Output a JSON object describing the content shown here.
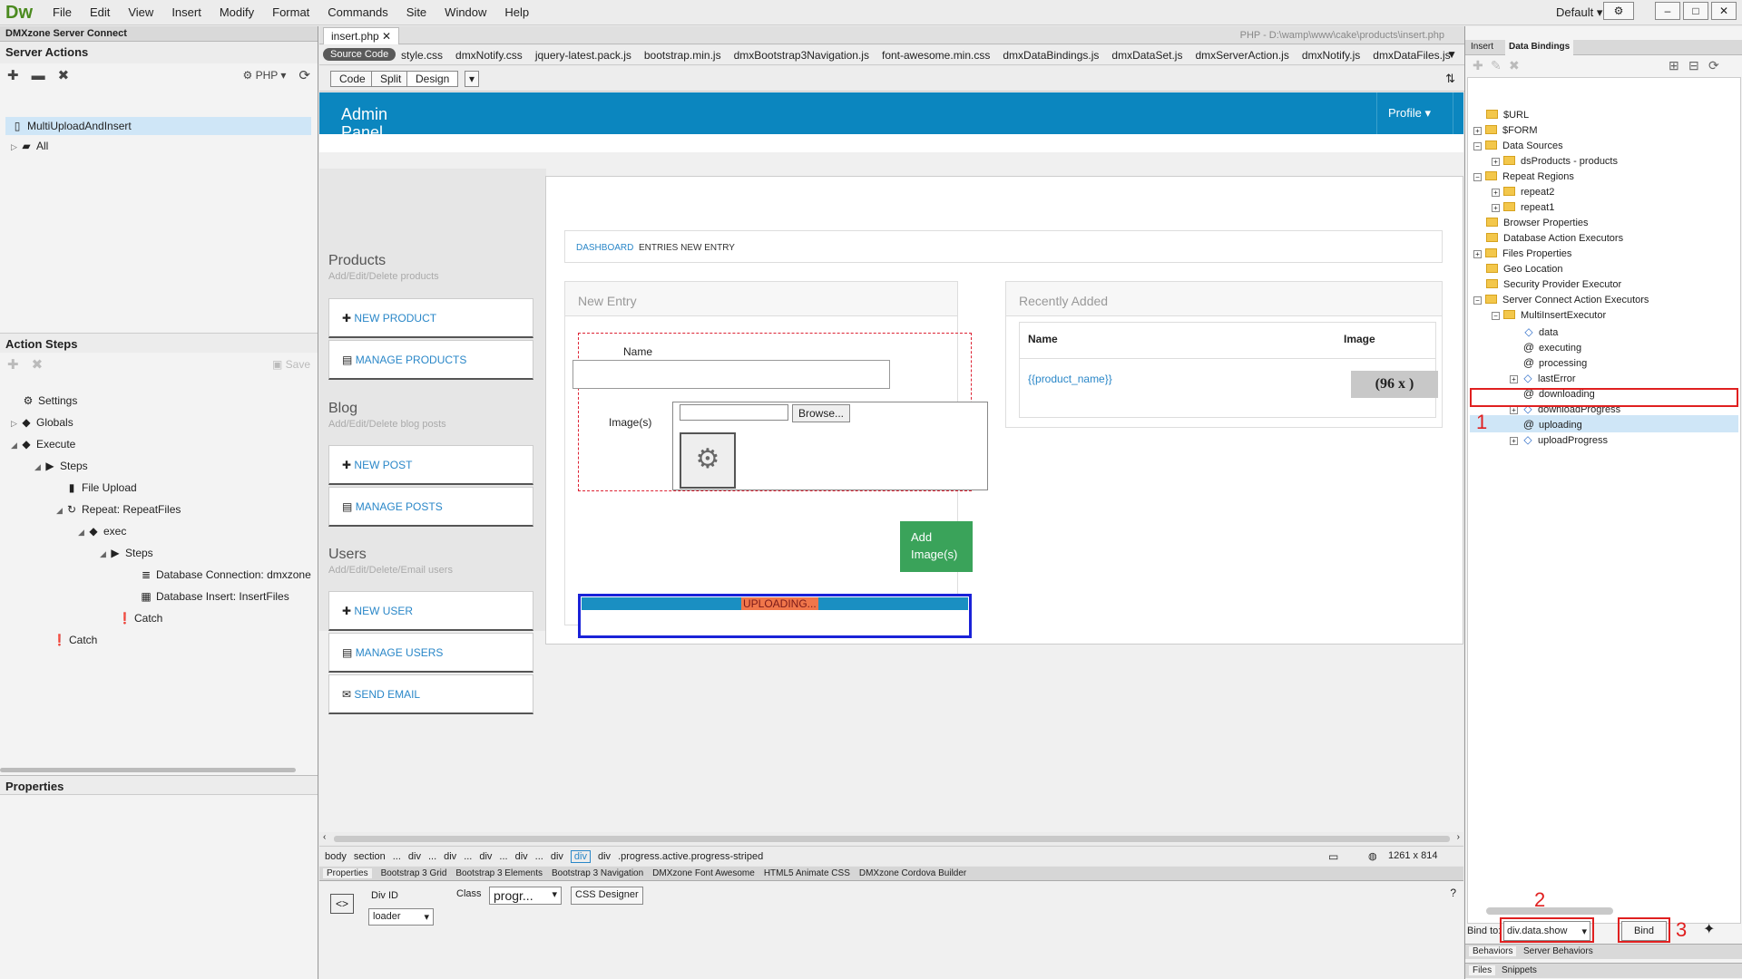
{
  "app": {
    "logo": "Dw",
    "menu": [
      "File",
      "Edit",
      "View",
      "Insert",
      "Modify",
      "Format",
      "Commands",
      "Site",
      "Window",
      "Help"
    ],
    "workspace": "Default",
    "window_buttons": [
      "–",
      "□",
      "✕"
    ]
  },
  "left": {
    "panel_tab": "DMXzone Server Connect",
    "server_actions_title": "Server Actions",
    "php_label": "PHP",
    "actions": [
      "MultiUploadAndInsert",
      "All"
    ],
    "action_steps_title": "Action Steps",
    "save_label": "Save",
    "steps": [
      "Settings",
      "Globals",
      "Execute",
      "Steps",
      "File Upload",
      "Repeat: RepeatFiles",
      "exec",
      "Steps",
      "Database Connection: dmxzone",
      "Database Insert: InsertFiles",
      "Catch",
      "Catch"
    ],
    "properties_title": "Properties"
  },
  "doc": {
    "tab": "insert.php",
    "path": "PHP - D:\\wamp\\www\\cake\\products\\insert.php",
    "source_code": "Source Code",
    "files": [
      "style.css",
      "dmxNotify.css",
      "jquery-latest.pack.js",
      "bootstrap.min.js",
      "dmxBootstrap3Navigation.js",
      "font-awesome.min.css",
      "dmxDataBindings.js",
      "dmxDataSet.js",
      "dmxServerAction.js",
      "dmxNotify.js",
      "dmxDataFiles.js"
    ],
    "views": [
      "Code",
      "Split",
      "Design"
    ]
  },
  "page": {
    "brand": "Admin Panel",
    "profile": "Profile",
    "sections": [
      {
        "title": "Products",
        "sub": "Add/Edit/Delete products",
        "items": [
          "NEW PRODUCT",
          "MANAGE PRODUCTS"
        ]
      },
      {
        "title": "Blog",
        "sub": "Add/Edit/Delete blog posts",
        "items": [
          "NEW POST",
          "MANAGE POSTS"
        ]
      },
      {
        "title": "Users",
        "sub": "Add/Edit/Delete/Email users",
        "items": [
          "NEW USER",
          "MANAGE USERS",
          "SEND EMAIL"
        ]
      }
    ],
    "breadcrumb_link": "DASHBOARD",
    "breadcrumb_rest": "ENTRIES NEW ENTRY",
    "new_entry": "New Entry",
    "name_label": "Name",
    "images_label": "Image(s)",
    "browse": "Browse...",
    "add_button": "Add Image(s)",
    "progress_text": "UPLOADING...",
    "recent_title": "Recently Added",
    "col_name": "Name",
    "col_image": "Image",
    "product_binding": "{{product_name}}",
    "image_placeholder": "(96 x )"
  },
  "status": {
    "tags": [
      "body",
      "section",
      "...",
      "div",
      "...",
      "div",
      "...",
      "div",
      "...",
      "div",
      "...",
      "div",
      "div",
      "div",
      ".progress.active.progress-striped"
    ],
    "size": "1261 x 814"
  },
  "props": {
    "tabs": [
      "Properties",
      "Bootstrap 3 Grid",
      "Bootstrap 3 Elements",
      "Bootstrap 3 Navigation",
      "DMXzone Font Awesome",
      "HTML5 Animate CSS",
      "DMXzone Cordova Builder"
    ],
    "div_id_label": "Div ID",
    "div_id": "loader",
    "class_label": "Class",
    "class_value": "progr...",
    "css_designer": "CSS Designer"
  },
  "right": {
    "tabs": [
      "Insert",
      "Data Bindings"
    ],
    "tree": [
      "$URL",
      "$FORM",
      "Data Sources",
      "dsProducts - products",
      "Repeat Regions",
      "repeat2",
      "repeat1",
      "Browser Properties",
      "Database Action Executors",
      "Files Properties",
      "Geo Location",
      "Security Provider Executor",
      "Server Connect Action Executors",
      "MultiInsertExecutor",
      "data",
      "executing",
      "processing",
      "lastError",
      "downloading",
      "downloadProgress",
      "uploading",
      "uploadProgress"
    ],
    "bind_to_label": "Bind to:",
    "bind_to_value": "div.data.show",
    "bind_button": "Bind",
    "bottom_tabs": [
      "Behaviors",
      "Server Behaviors"
    ],
    "bottom_tabs2": [
      "Files",
      "Snippets"
    ],
    "annotations": [
      "1",
      "2",
      "3"
    ]
  },
  "colors": {
    "brand_blue": "#0b86bf",
    "accent_green": "#3aa35a",
    "progress_orange": "#f0764a",
    "annotation_red": "#e02020",
    "highlight_blue": "#1a22d8"
  }
}
